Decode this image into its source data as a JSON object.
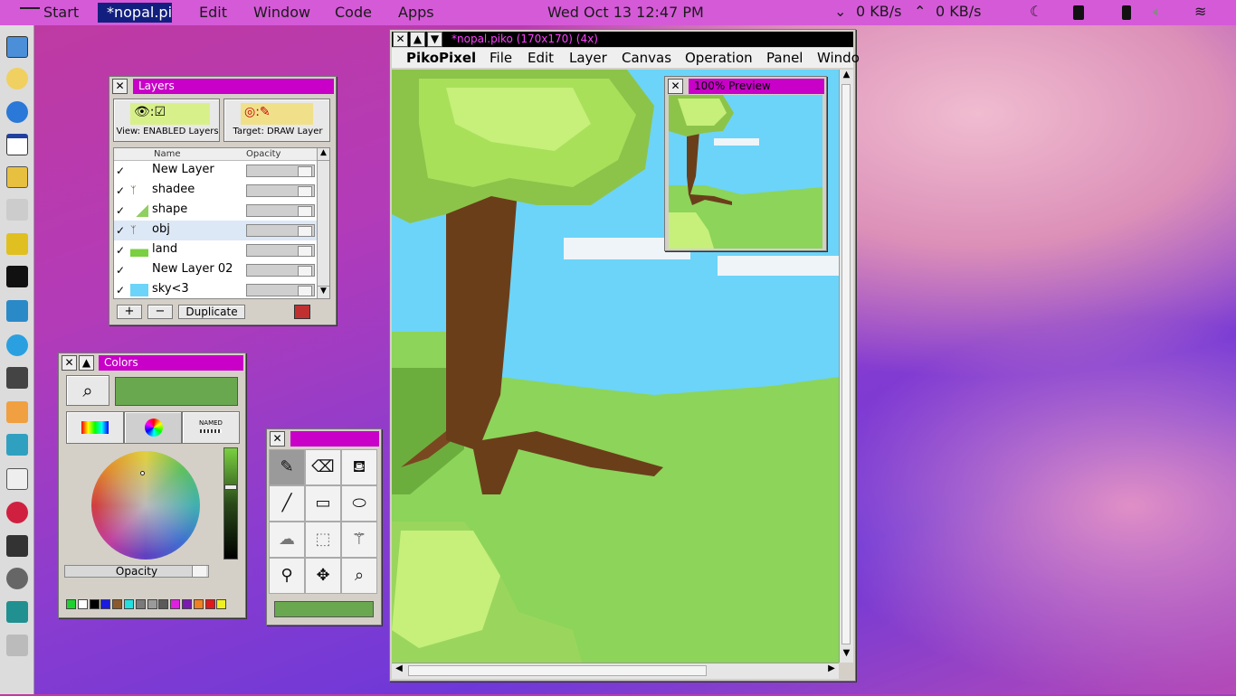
{
  "topbar": {
    "start": "Start",
    "active_app": "*nopal.pi...",
    "menus": [
      "Edit",
      "Window",
      "Code",
      "Apps"
    ],
    "datetime": "Wed Oct 13   12:47 PM",
    "net_down": "0 KB/s",
    "net_up": "0 KB/s"
  },
  "layers": {
    "title": "Layers",
    "view_label": "View: ENABLED Layers",
    "target_label": "Target: DRAW Layer",
    "col_name": "Name",
    "col_opacity": "Opacity",
    "rows": [
      {
        "name": "New Layer"
      },
      {
        "name": "shadee"
      },
      {
        "name": "shape"
      },
      {
        "name": "obj"
      },
      {
        "name": "land"
      },
      {
        "name": "New Layer 02"
      },
      {
        "name": "sky<3"
      }
    ],
    "add": "+",
    "remove": "−",
    "duplicate": "Duplicate"
  },
  "colors": {
    "title": "Colors",
    "named_label": "NAMED",
    "opacity_label": "Opacity",
    "current_color": "#6aa84f",
    "palette": [
      "#1fd12e",
      "#ffffff",
      "#000000",
      "#1a1ae0",
      "#8b5a2b",
      "#22e0e0",
      "#7a7a7a",
      "#9a9a9a",
      "#5a5a5a",
      "#e020e0",
      "#7a1ab0",
      "#f08020",
      "#e01a1a",
      "#f0f020"
    ]
  },
  "tools": {
    "current_color": "#6aa84f"
  },
  "piko": {
    "title": "*nopal.piko (170x170) (4x)",
    "menus": [
      "PikoPixel",
      "File",
      "Edit",
      "Layer",
      "Canvas",
      "Operation",
      "Panel",
      "Windo"
    ]
  },
  "preview": {
    "title": "100% Preview"
  }
}
